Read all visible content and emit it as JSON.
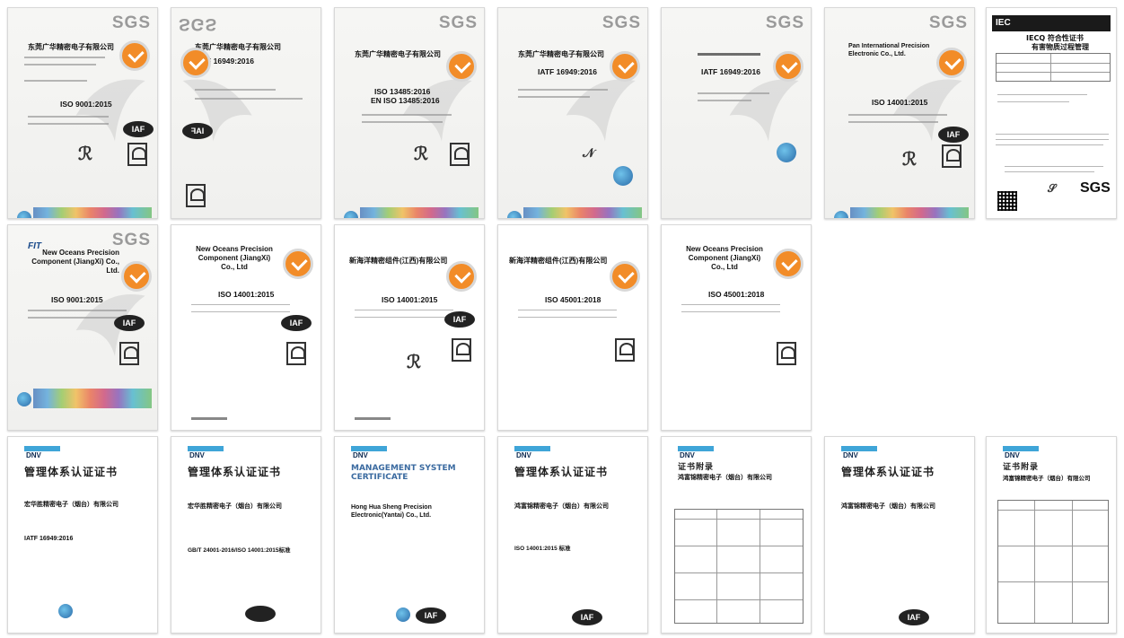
{
  "row1": [
    {
      "id": "c1",
      "logo": "SGS",
      "company": "东莞广华精密电子有限公司",
      "standard": "ISO 9001:2015",
      "iaf": "IAF"
    },
    {
      "id": "c2",
      "logo": "SGS",
      "company": "东莞广华精密电子有限公司",
      "standard": "IATF 16949:2016",
      "iaf": "IAF"
    },
    {
      "id": "c3",
      "logo": "SGS",
      "company": "东莞广华精密电子有限公司",
      "standard": "ISO 13485:2016",
      "standard2": "EN ISO 13485:2016"
    },
    {
      "id": "c4",
      "logo": "SGS",
      "company": "东莞广华精密电子有限公司",
      "standard": "IATF 16949:2016"
    },
    {
      "id": "c5",
      "logo": "SGS",
      "company": "",
      "standard": "IATF 16949:2016"
    },
    {
      "id": "c6",
      "logo": "SGS",
      "company": "Pan International Precision Electronic Co., Ltd.",
      "standard": "ISO 14001:2015",
      "iaf": "IAF"
    },
    {
      "id": "c7",
      "logo": "IEC",
      "title": "IECQ 符合性证书",
      "subtitle": "有害物质过程管理",
      "footer_logo": "SGS"
    }
  ],
  "row2": [
    {
      "id": "c8",
      "logo": "SGS",
      "company": "New Oceans Precision Component (JiangXi) Co., Ltd.",
      "standard": "ISO 9001:2015",
      "iaf": "IAF"
    },
    {
      "id": "c9",
      "company": "New Oceans Precision Component (JiangXi) Co., Ltd",
      "standard": "ISO 14001:2015",
      "iaf": "IAF"
    },
    {
      "id": "c10",
      "company": "新海洋精密组件(江西)有限公司",
      "standard": "ISO 14001:2015",
      "iaf": "IAF"
    },
    {
      "id": "c11",
      "company": "新海洋精密组件(江西)有限公司",
      "standard": "ISO 45001:2018"
    },
    {
      "id": "c12",
      "company": "New Oceans Precision Component (JiangXi) Co., Ltd",
      "standard": "ISO 45001:2018"
    }
  ],
  "row3": [
    {
      "id": "c13",
      "logo": "DNV",
      "heading": "管理体系认证证书",
      "company": "宏华胜精密电子（烟台）有限公司",
      "standard": "IATF 16949:2016"
    },
    {
      "id": "c14",
      "logo": "DNV",
      "heading": "管理体系认证证书",
      "company": "宏华胜精密电子（烟台）有限公司",
      "standard": "GB/T 24001-2016/ISO 14001:2015标准"
    },
    {
      "id": "c15",
      "logo": "DNV",
      "heading": "MANAGEMENT SYSTEM",
      "heading2": "CERTIFICATE",
      "company": "Hong Hua Sheng Precision Electronic(Yantai) Co., Ltd.",
      "iaf": "IAF"
    },
    {
      "id": "c16",
      "logo": "DNV",
      "heading": "管理体系认证证书",
      "company": "鸿富锦精密电子（烟台）有限公司",
      "standard": "ISO 14001:2015 标准",
      "iaf": "IAF"
    },
    {
      "id": "c17",
      "logo": "DNV",
      "heading": "证书附录",
      "company": "鸿富锦精密电子（烟台）有限公司"
    },
    {
      "id": "c18",
      "logo": "DNV",
      "heading": "管理体系认证证书",
      "company": "鸿富锦精密电子（烟台）有限公司",
      "iaf": "IAF"
    },
    {
      "id": "c19",
      "logo": "DNV",
      "heading": "证书附录",
      "company": "鸿富锦精密电子（烟台）有限公司"
    }
  ]
}
